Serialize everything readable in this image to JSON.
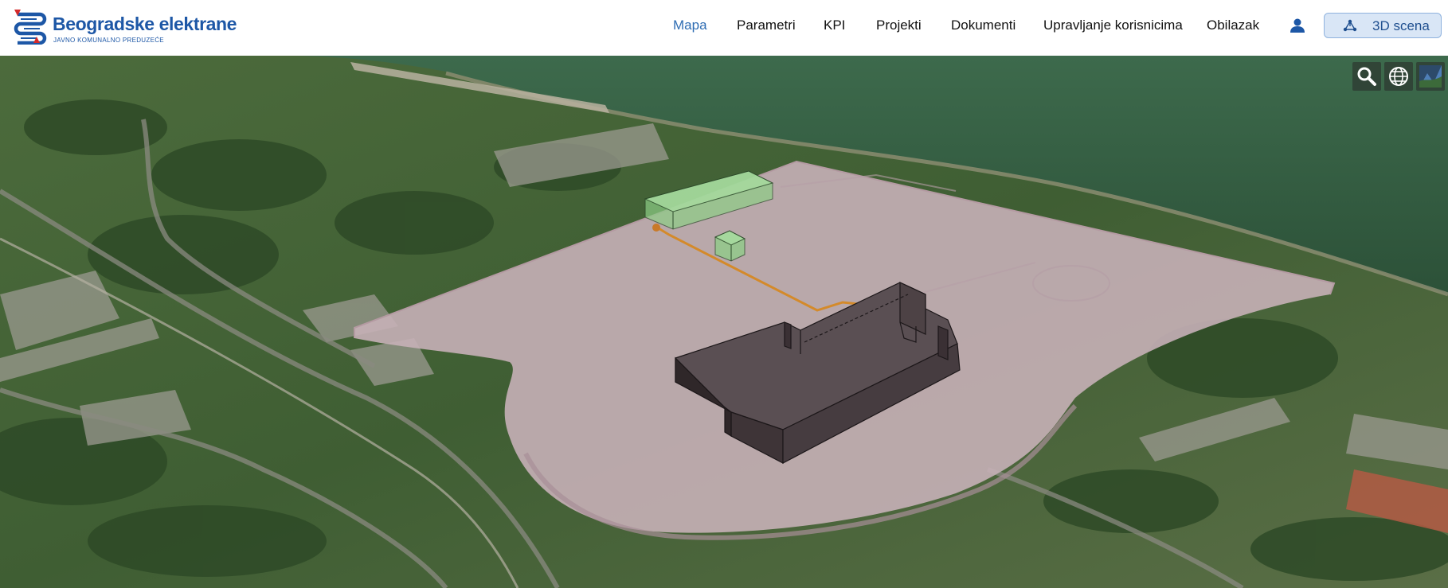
{
  "app": {
    "logo_title": "Beogradske elektrane",
    "logo_subtitle": "JAVNO KOMUNALNO PREDUZEĆE"
  },
  "nav": {
    "items": [
      {
        "label": "Mapa",
        "active": true
      },
      {
        "label": "Parametri",
        "active": false
      },
      {
        "label": "KPI",
        "active": false
      },
      {
        "label": "Projekti",
        "active": false
      },
      {
        "label": "Dokumenti",
        "active": false
      },
      {
        "label": "Upravljanje korisnicima",
        "active": false
      },
      {
        "label": "Obilazak",
        "active": false
      }
    ],
    "user_icon": "user-icon",
    "scene_button": {
      "label": "3D scena",
      "icon": "3d-scene-icon"
    }
  },
  "map_tools": [
    {
      "icon": "search-icon"
    },
    {
      "icon": "globe-icon"
    },
    {
      "icon": "base-layer-picker-icon"
    }
  ],
  "colors": {
    "brand_blue": "#1d57a6",
    "nav_active": "#2f6db3",
    "site_footprint": "#c8b4bb",
    "building_dark": "#4a4043",
    "building_green": "#7ec27a",
    "pipeline": "#d48a2a",
    "river": "#2f5a3e"
  }
}
